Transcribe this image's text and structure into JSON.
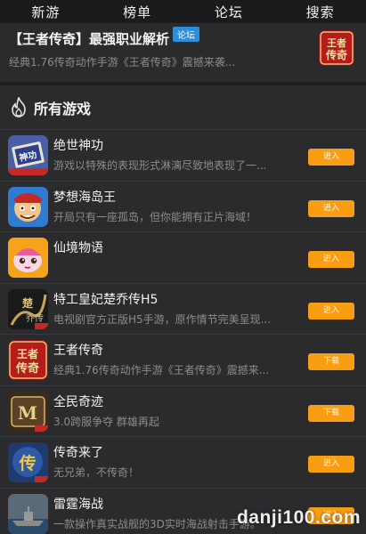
{
  "nav": [
    "新游",
    "榜单",
    "论坛",
    "搜索"
  ],
  "featured": {
    "title": "【王者传奇】最强职业解析",
    "tag": "论坛",
    "desc": "经典1.76传奇动作手游《王者传奇》震撼来袭..."
  },
  "section_title": "所有游戏",
  "games": [
    {
      "name": "绝世神功",
      "desc": "游戏以特殊的表现形式淋漓尽致地表现了一...",
      "button": "进入",
      "icon": "jueshi-shengong-icon"
    },
    {
      "name": "梦想海岛王",
      "desc": "开局只有一座孤岛，但你能拥有正片海域！",
      "button": "进入",
      "icon": "mengxiang-haidaowang-icon"
    },
    {
      "name": "仙境物语",
      "desc": "",
      "button": "进入",
      "icon": "xianjing-wuyu-icon"
    },
    {
      "name": "特工皇妃楚乔传H5",
      "desc": "电视剧官方正版H5手游，原作情节完美呈现...",
      "button": "进入",
      "icon": "chuqiao-zhuan-icon"
    },
    {
      "name": "王者传奇",
      "desc": "经典1.76传奇动作手游《王者传奇》震撼来...",
      "button": "下载",
      "icon": "wangzhe-chuanqi-icon"
    },
    {
      "name": "全民奇迹",
      "desc": "3.0跨服争夺 群雄再起",
      "button": "下载",
      "icon": "quanmin-qiji-icon"
    },
    {
      "name": "传奇来了",
      "desc": "无兄弟，不传奇！",
      "button": "进入",
      "icon": "chuanqi-laile-icon"
    },
    {
      "name": "雷霆海战",
      "desc": "一款操作真实战舰的3D实时海战射击手游。",
      "button": "进入",
      "icon": "leiting-haizhan-icon"
    }
  ],
  "watermark": "danji100.com",
  "colors": {
    "accent_button": "#f99d13",
    "tag_blue": "#2c8ed8",
    "background": "#2b2b2e"
  }
}
